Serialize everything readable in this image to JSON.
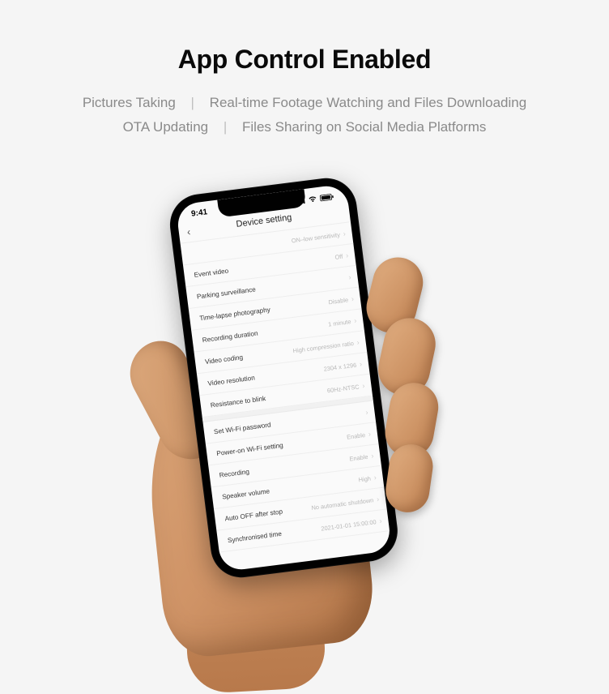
{
  "headline": "App Control Enabled",
  "features": {
    "line1a": "Pictures Taking",
    "line1b": "Real-time Footage Watching and Files Downloading",
    "line2a": "OTA Updating",
    "line2b": "Files Sharing on Social Media Platforms"
  },
  "phone": {
    "status": {
      "time": "9:41"
    },
    "title": "Device setting",
    "rows": [
      {
        "label": "",
        "value": "ON–low sensitivity"
      },
      {
        "label": "Event video",
        "value": "Off"
      },
      {
        "label": "Parking surveillance",
        "value": ""
      },
      {
        "label": "Time-lapse photography",
        "value": "Disable"
      },
      {
        "label": "Recording duration",
        "value": "1 minute"
      },
      {
        "label": "Video coding",
        "value": "High compression ratio"
      },
      {
        "label": "Video resolution",
        "value": "2304 x 1296"
      },
      {
        "label": "Resistance to blink",
        "value": "60Hz-NTSC"
      }
    ],
    "rows2": [
      {
        "label": "Set Wi-Fi password",
        "value": ""
      },
      {
        "label": "Power-on Wi-Fi setting",
        "value": "Enable"
      },
      {
        "label": "Recording",
        "value": "Enable"
      },
      {
        "label": "Speaker volume",
        "value": "High"
      },
      {
        "label": "Auto OFF after stop",
        "value": "No automatic shutdown"
      },
      {
        "label": "Synchronised time",
        "value": "2021-01-01 15:00:00"
      }
    ]
  }
}
